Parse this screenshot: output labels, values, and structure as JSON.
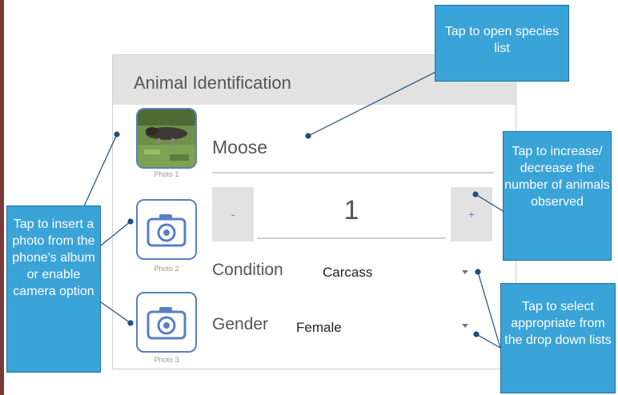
{
  "form": {
    "title": "Animal Identification",
    "species": "Moose",
    "photos": [
      {
        "caption": "Photo 1"
      },
      {
        "caption": "Photo 2"
      },
      {
        "caption": "Photo 3"
      }
    ],
    "count": {
      "decrement_label": "-",
      "value": "1",
      "increment_label": "+"
    },
    "condition": {
      "label": "Condition",
      "value": "Carcass"
    },
    "gender": {
      "label": "Gender",
      "value": "Female"
    }
  },
  "icons": {
    "photo_placeholder": "camera-icon",
    "dropdown": "chevron-down-icon"
  },
  "colors": {
    "callout_fill": "#3aa3d8",
    "callout_border": "#1f6f9f",
    "photo_border": "#5a7ec4",
    "header_bg": "#e2e2e2"
  },
  "callouts": {
    "species": "Tap to open species list",
    "count": "Tap to increase/ decrease the number of animals observed",
    "photo": "Tap to insert a photo from the phone's album or enable camera option",
    "dropdown": "Tap to select appropriate from the drop down lists"
  }
}
